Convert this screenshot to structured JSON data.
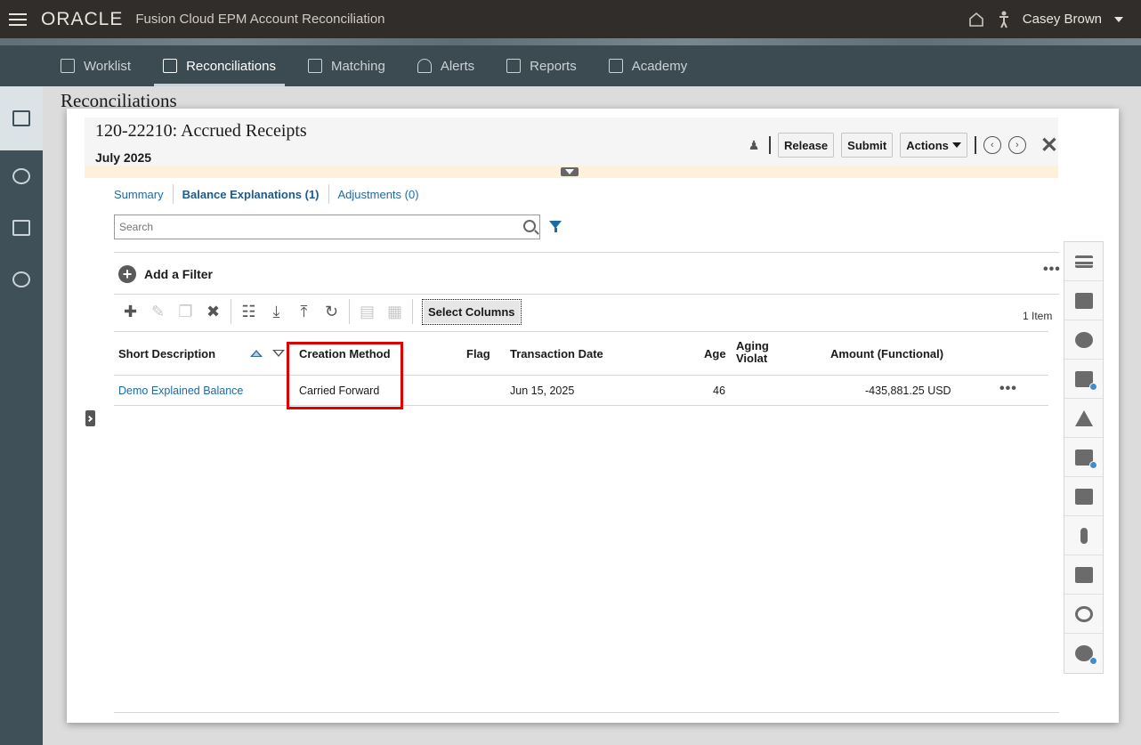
{
  "header": {
    "logo": "ORACLE",
    "app_title": "Fusion Cloud EPM Account Reconciliation",
    "user_name": "Casey Brown"
  },
  "nav": {
    "tabs": [
      {
        "label": "Worklist",
        "icon": "worklist-icon"
      },
      {
        "label": "Reconciliations",
        "icon": "reconciliations-icon",
        "active": true
      },
      {
        "label": "Matching",
        "icon": "matching-icon"
      },
      {
        "label": "Alerts",
        "icon": "bell-icon"
      },
      {
        "label": "Reports",
        "icon": "reports-icon"
      },
      {
        "label": "Academy",
        "icon": "play-icon"
      }
    ]
  },
  "background_page": {
    "title": "Reconciliations"
  },
  "dialog": {
    "title": "120-22210: Accrued Receipts",
    "period": "July 2025",
    "buttons": {
      "release": "Release",
      "submit": "Submit",
      "actions": "Actions"
    },
    "tabs": [
      {
        "label": "Summary"
      },
      {
        "label": "Balance Explanations (1)",
        "active": true
      },
      {
        "label": "Adjustments (0)"
      }
    ],
    "search": {
      "placeholder": "Search"
    },
    "add_filter_label": "Add a Filter",
    "select_columns_label": "Select Columns",
    "item_count": "1 Item",
    "table": {
      "columns": [
        "Short Description",
        "Creation Method",
        "Flag",
        "Transaction Date",
        "Age",
        "Aging Violat",
        "Amount (Functional)"
      ],
      "rows": [
        {
          "short_description": "Demo Explained Balance",
          "creation_method": "Carried Forward",
          "flag": "",
          "transaction_date": "Jun 15, 2025",
          "age": "46",
          "aging_violation": "",
          "amount": "-435,881.25 USD"
        }
      ]
    }
  },
  "colors": {
    "topbar": "#312d2a",
    "navstrip": "#3c4a52",
    "link": "#1e6aa6",
    "highlight": "#e00000"
  }
}
